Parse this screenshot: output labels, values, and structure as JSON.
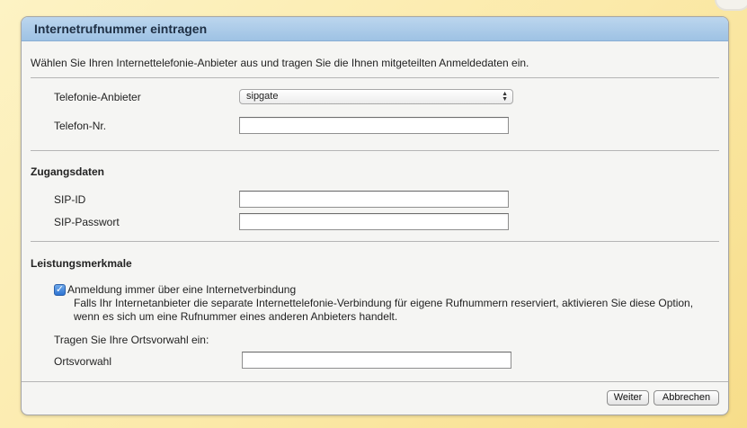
{
  "dialog": {
    "title": "Internetrufnummer eintragen",
    "intro": "Wählen Sie Ihren Internettelefonie-Anbieter aus und tragen Sie die Ihnen mitgeteilten Anmeldedaten ein."
  },
  "provider": {
    "label": "Telefonie-Anbieter",
    "selected": "sipgate",
    "arrows_icon": "up-down-arrows-icon"
  },
  "phone": {
    "label": "Telefon-Nr.",
    "value": ""
  },
  "access": {
    "title": "Zugangsdaten",
    "sip_id_label": "SIP-ID",
    "sip_id_value": "",
    "sip_password_label": "SIP-Passwort",
    "sip_password_value": ""
  },
  "features": {
    "title": "Leistungsmerkmale",
    "checkbox_label": "Anmeldung immer über eine Internetverbindung",
    "checkbox_checked": true,
    "checkbox_desc": "Falls Ihr Internetanbieter die separate Internettelefonie-Verbindung für eigene Rufnummern reserviert, aktivieren Sie diese Option, wenn es sich um eine Rufnummer eines anderen Anbieters handelt.",
    "area_code_prompt": "Tragen Sie Ihre Ortsvorwahl ein:",
    "area_code_label": "Ortsvorwahl",
    "area_code_value": ""
  },
  "buttons": {
    "next": "Weiter",
    "cancel": "Abbrechen"
  },
  "colors": {
    "header_bg": "#a8c8e8",
    "page_bg": "#fbe9a8",
    "panel_bg": "#f5f5f3",
    "checkbox_accent": "#3a7fd8"
  }
}
